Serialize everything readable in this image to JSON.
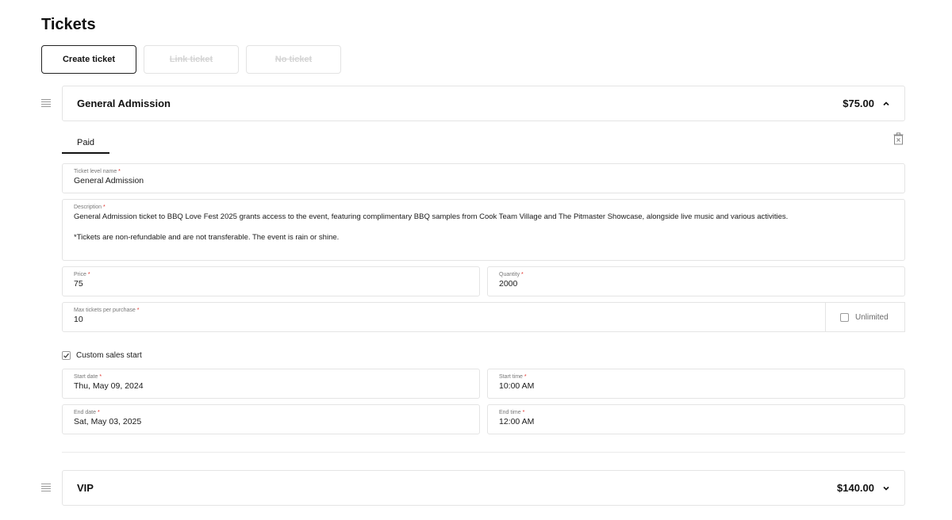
{
  "page": {
    "title": "Tickets"
  },
  "actions": {
    "create_label": "Create ticket",
    "link_label": "Link ticket",
    "no_ticket_label": "No ticket"
  },
  "tickets": [
    {
      "name": "General Admission",
      "price_display": "$75.00",
      "expanded": true,
      "tab": "Paid",
      "fields": {
        "name_label": "Ticket level name",
        "name_value": "General Admission",
        "description_label": "Description",
        "description_line1": "General Admission ticket to BBQ Love Fest 2025 grants access to the event, featuring complimentary BBQ samples from Cook Team Village and The Pitmaster Showcase, alongside live music and various activities.",
        "description_line2": "*Tickets are non-refundable and are not transferable. The event is rain or shine.",
        "price_label": "Price",
        "price_value": "75",
        "quantity_label": "Quantity",
        "quantity_value": "2000",
        "max_label": "Max tickets per purchase",
        "max_value": "10",
        "unlimited_label": "Unlimited",
        "unlimited_checked": false,
        "custom_sales_label": "Custom sales start",
        "custom_sales_checked": true,
        "start_date_label": "Start date",
        "start_date_value": "Thu, May 09, 2024",
        "start_time_label": "Start time",
        "start_time_value": "10:00 AM",
        "end_date_label": "End date",
        "end_date_value": "Sat, May 03, 2025",
        "end_time_label": "End time",
        "end_time_value": "12:00 AM"
      }
    },
    {
      "name": "VIP",
      "price_display": "$140.00",
      "expanded": false
    }
  ],
  "required_marker": "*",
  "icons": {
    "drag": "drag-handle-icon",
    "chevron_up": "chevron-up-icon",
    "chevron_down": "chevron-down-icon",
    "trash": "trash-icon",
    "check": "check-icon"
  },
  "colors": {
    "required": "#e0302a",
    "border": "#e4e4e4",
    "text": "#1a1a1a"
  }
}
